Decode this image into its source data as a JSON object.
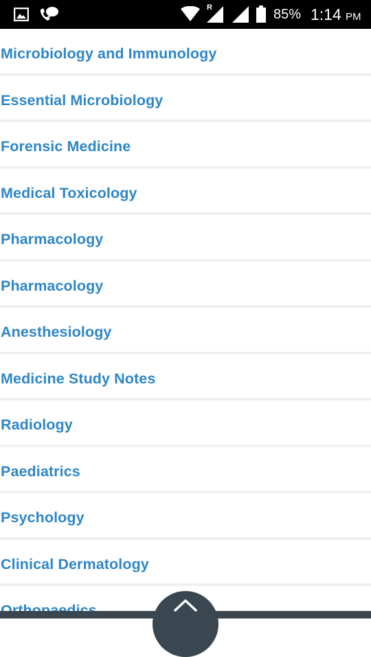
{
  "status_bar": {
    "battery_percent": "85%",
    "time": "1:14",
    "am_pm": "PM",
    "roaming_indicator": "R",
    "icons": [
      "gallery-icon",
      "phone-chat-icon",
      "wifi-icon",
      "signal-roaming-icon",
      "signal-icon",
      "battery-icon"
    ]
  },
  "list": {
    "items": [
      {
        "label": "Microbiology and Immunology"
      },
      {
        "label": "Essential Microbiology"
      },
      {
        "label": "Forensic Medicine"
      },
      {
        "label": "Medical Toxicology"
      },
      {
        "label": "Pharmacology"
      },
      {
        "label": "Pharmacology"
      },
      {
        "label": "Anesthesiology"
      },
      {
        "label": "Medicine Study Notes"
      },
      {
        "label": "Radiology"
      },
      {
        "label": "Paediatrics"
      },
      {
        "label": "Psychology"
      },
      {
        "label": "Clinical Dermatology"
      },
      {
        "label": "Orthopaedics"
      }
    ]
  },
  "colors": {
    "link_text": "#2e86c8",
    "status_bar_bg": "#000000",
    "bottom_bar_bg": "#3a4750"
  },
  "scroll_top_icon": "chevron-up-icon"
}
